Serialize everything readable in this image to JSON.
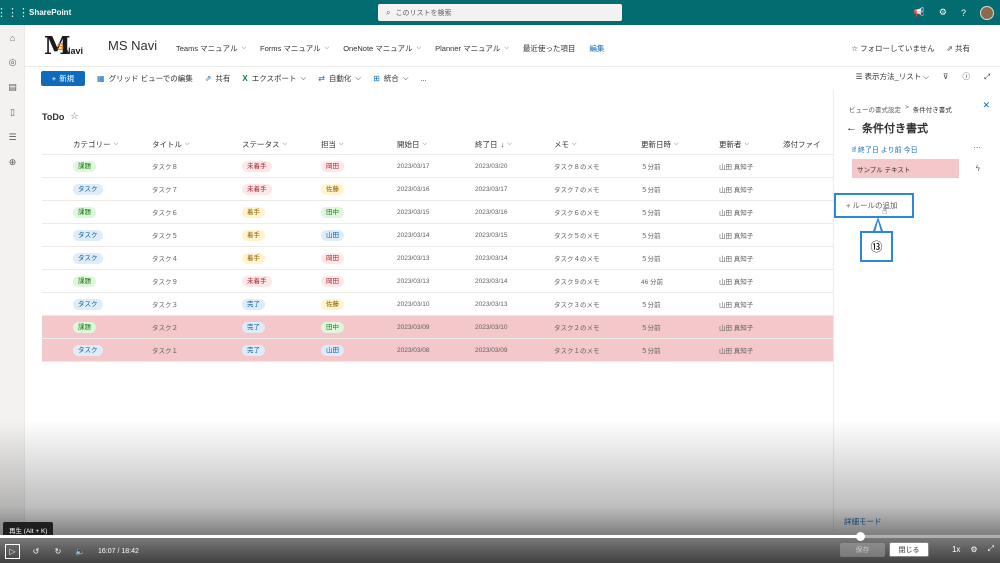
{
  "suitebar": {
    "app_name": "SharePoint",
    "search_placeholder": "このリストを検索"
  },
  "site": {
    "logo_m": "M",
    "logo_s": "S",
    "logo_navi": "Navi",
    "title": "MS Navi",
    "nav": [
      {
        "label": "Teams マニュアル"
      },
      {
        "label": "Forms マニュアル"
      },
      {
        "label": "OneNote マニュアル"
      },
      {
        "label": "Planner マニュアル"
      }
    ],
    "recent": "最近使った項目",
    "edit": "編集",
    "follow": "フォローしていません",
    "share": "共有"
  },
  "cmdbar": {
    "new": "新規",
    "grid_edit": "グリッド ビューでの編集",
    "share": "共有",
    "export": "エクスポート",
    "automate": "自動化",
    "integrate": "統合",
    "more": "...",
    "view_options": "表示方法_リスト"
  },
  "list": {
    "title": "ToDo",
    "columns": [
      "カテゴリー",
      "タイトル",
      "ステータス",
      "担当",
      "開始日",
      "終了日",
      "メモ",
      "更新日時",
      "更新者",
      "添付ファイ"
    ],
    "rows": [
      {
        "category": "課題",
        "title": "タスク８",
        "status": "未着手",
        "owner": "岡田",
        "start": "2023/03/17",
        "end": "2023/03/20",
        "memo": "タスク８のメモ",
        "updated": "５分前",
        "editor": "山田 真知子",
        "highlight": false
      },
      {
        "category": "タスク",
        "title": "タスク７",
        "status": "未着手",
        "owner": "佐藤",
        "start": "2023/03/16",
        "end": "2023/03/17",
        "memo": "タスク７のメモ",
        "updated": "５分前",
        "editor": "山田 真知子",
        "highlight": false
      },
      {
        "category": "課題",
        "title": "タスク６",
        "status": "着手",
        "owner": "田中",
        "start": "2023/03/15",
        "end": "2023/03/16",
        "memo": "タスク６のメモ",
        "updated": "５分前",
        "editor": "山田 真知子",
        "highlight": false
      },
      {
        "category": "タスク",
        "title": "タスク５",
        "status": "着手",
        "owner": "山田",
        "start": "2023/03/14",
        "end": "2023/03/15",
        "memo": "タスク５のメモ",
        "updated": "５分前",
        "editor": "山田 真知子",
        "highlight": false
      },
      {
        "category": "タスク",
        "title": "タスク４",
        "status": "着手",
        "owner": "岡田",
        "start": "2023/03/13",
        "end": "2023/03/14",
        "memo": "タスク４のメモ",
        "updated": "５分前",
        "editor": "山田 真知子",
        "highlight": false
      },
      {
        "category": "課題",
        "title": "タスク９",
        "status": "未着手",
        "owner": "岡田",
        "start": "2023/03/13",
        "end": "2023/03/14",
        "memo": "タスク９のメモ",
        "updated": "46 分前",
        "editor": "山田 真知子",
        "highlight": false
      },
      {
        "category": "タスク",
        "title": "タスク３",
        "status": "完了",
        "owner": "佐藤",
        "start": "2023/03/10",
        "end": "2023/03/13",
        "memo": "タスク３のメモ",
        "updated": "５分前",
        "editor": "山田 真知子",
        "highlight": false
      },
      {
        "category": "課題",
        "title": "タスク２",
        "status": "完了",
        "owner": "田中",
        "start": "2023/03/09",
        "end": "2023/03/10",
        "memo": "タスク２のメモ",
        "updated": "５分前",
        "editor": "山田 真知子",
        "highlight": true
      },
      {
        "category": "タスク",
        "title": "タスク１",
        "status": "完了",
        "owner": "山田",
        "start": "2023/03/08",
        "end": "2023/03/09",
        "memo": "タスク１のメモ",
        "updated": "５分前",
        "editor": "山田 真知子",
        "highlight": true
      }
    ],
    "pill_colors": {
      "課題": {
        "bg": "#dff6dd",
        "fg": "#107c10"
      },
      "タスク": {
        "bg": "#deecf9",
        "fg": "#005a9e"
      },
      "未着手": {
        "bg": "#fde7e9",
        "fg": "#a4262c"
      },
      "着手": {
        "bg": "#fff4ce",
        "fg": "#8a5d00"
      },
      "完了": {
        "bg": "#deecf9",
        "fg": "#005a9e"
      },
      "岡田": {
        "bg": "#fde7e9",
        "fg": "#a4262c"
      },
      "佐藤": {
        "bg": "#fff4ce",
        "fg": "#8a5d00"
      },
      "田中": {
        "bg": "#dff6dd",
        "fg": "#107c10"
      },
      "山田": {
        "bg": "#deecf9",
        "fg": "#005a9e"
      }
    }
  },
  "panel": {
    "crumb_parent": "ビューの書式設定",
    "crumb_sep": ">",
    "crumb_current": "条件付き書式",
    "title": "条件付き書式",
    "rule": "終了日 より前 今日",
    "sample": "サンプル テキスト",
    "add_rule": "ルールの追加",
    "callout_number": "⑬",
    "advanced": "詳細モード"
  },
  "player": {
    "tooltip": "再生 (Alt + K)",
    "time": "16:07 / 18:42",
    "progress": 0.86,
    "speed": "1x",
    "save": "保存",
    "close": "閉じる"
  }
}
